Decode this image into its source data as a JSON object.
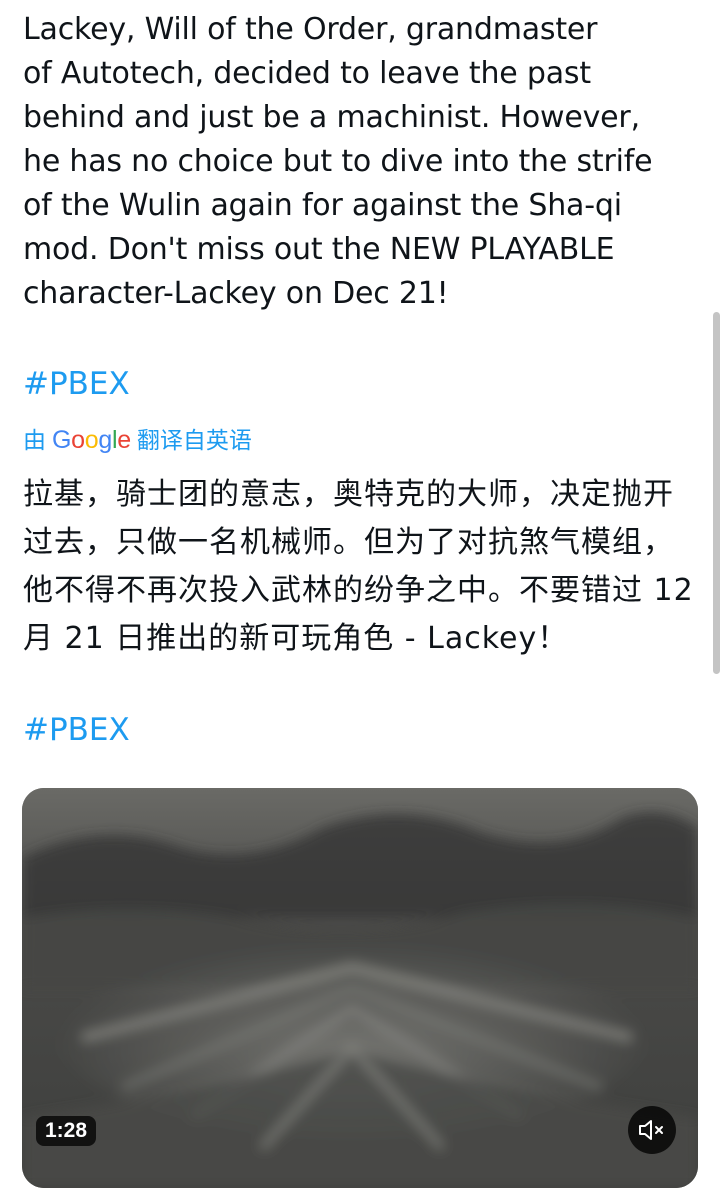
{
  "tweet": {
    "text": "Lackey, Will of the Order, grandmaster\nof Autotech, decided to leave the past\nbehind and just be a machinist. However,\nhe has no choice but to dive into the strife\nof the Wulin again for against the Sha-qi\nmod. Don't miss out the NEW PLAYABLE\ncharacter-Lackey on Dec 21!",
    "hashtag": "#PBEX"
  },
  "translation": {
    "prefix": "由",
    "provider": "Google",
    "suffix": "翻译自英语",
    "text": "拉基，骑士团的意志，奥特克的大师，决定抛开过去，只做一名机械师。但为了对抗煞气模组，他不得不再次投入武林的纷争之中。不要错过 12 月 21 日推出的新可玩角色 - Lackey！",
    "hashtag": "#PBEX"
  },
  "media": {
    "type": "video",
    "duration": "1:28",
    "mute_icon": "speaker-muted-icon"
  },
  "colors": {
    "text": "#0f1419",
    "link": "#1d9bf0",
    "muted": "#536471"
  }
}
